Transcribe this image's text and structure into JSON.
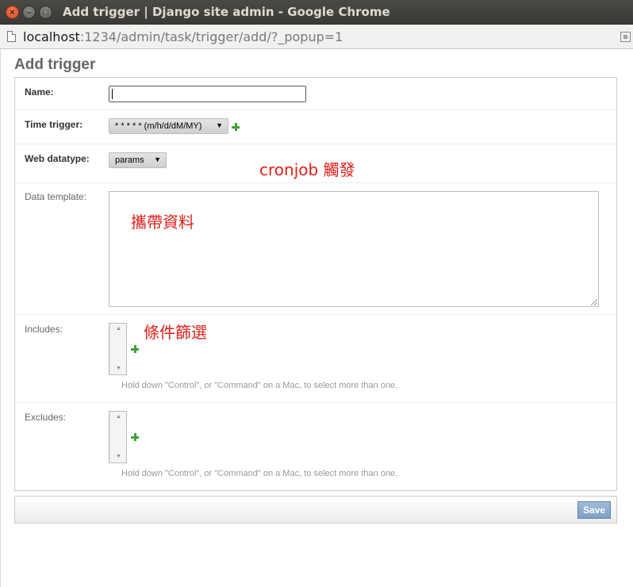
{
  "window": {
    "title": "Add trigger | Django site admin - Google Chrome",
    "close_glyph": "×",
    "min_glyph": "–",
    "max_glyph": "□"
  },
  "address_bar": {
    "host": "localhost",
    "path": ":1234/admin/task/trigger/add/?_popup=1"
  },
  "page": {
    "title": "Add trigger"
  },
  "form": {
    "name": {
      "label": "Name:",
      "value": ""
    },
    "time_trigger": {
      "label": "Time trigger:",
      "selected": "* * * * * (m/h/d/dM/MY)"
    },
    "web_datatype": {
      "label": "Web datatype:",
      "selected": "params"
    },
    "data_template": {
      "label": "Data template:",
      "value": ""
    },
    "includes": {
      "label": "Includes:",
      "help": "Hold down \"Control\", or \"Command\" on a Mac, to select more than one."
    },
    "excludes": {
      "label": "Excludes:",
      "help": "Hold down \"Control\", or \"Command\" on a Mac, to select more than one."
    }
  },
  "annotations": {
    "time_trigger": "cronjob 觸發",
    "data_template": "攜帶資料",
    "includes": "條件篩選"
  },
  "submit": {
    "save_label": "Save"
  },
  "icons": {
    "dropdown_arrow": "▼",
    "scroll_up": "▲",
    "scroll_down": "▼"
  },
  "colors": {
    "annotation": "#e0201a",
    "add_icon": "#3fa33a",
    "save_button": "#7d9fc4"
  }
}
